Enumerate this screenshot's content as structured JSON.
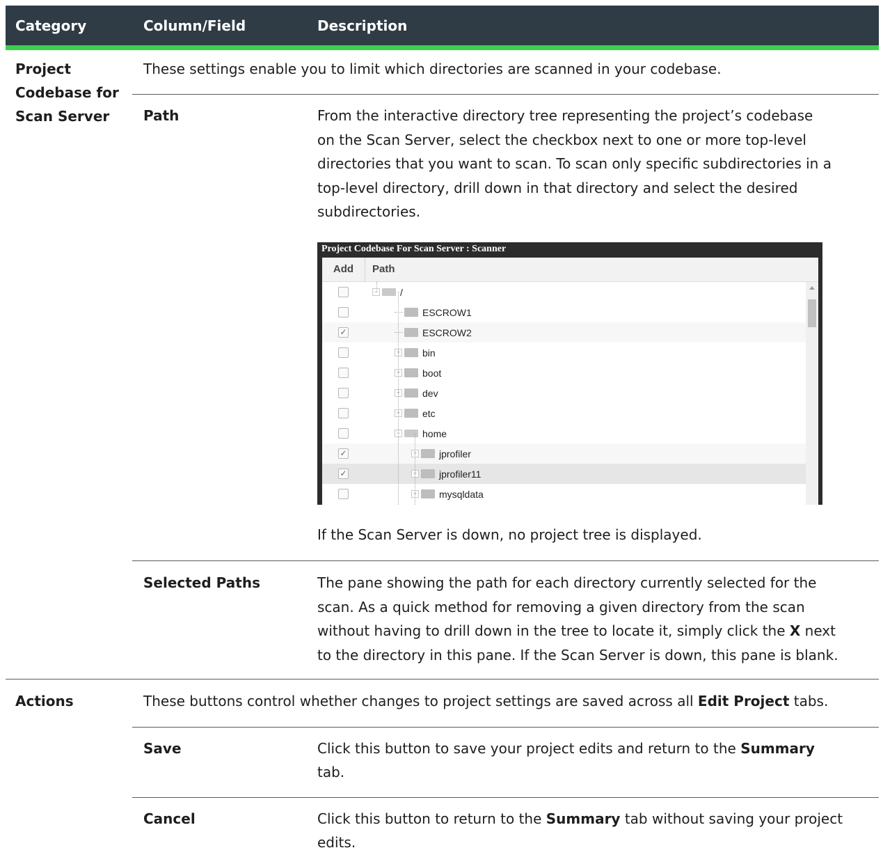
{
  "header": {
    "col_category": "Category",
    "col_field": "Column/Field",
    "col_description": "Description"
  },
  "section1": {
    "category_line1": "Project",
    "category_line2": "Codebase for",
    "category_line3": "Scan Server",
    "intro": "These settings enable you to limit which directories are scanned in your codebase.",
    "path_field": "Path",
    "path_desc": [
      "From the interactive directory tree representing the project’s codebase",
      "on the Scan Server, select the checkbox next to one or more top-level",
      "directories that you want to scan. To scan only specific subdirectories in a",
      "top-level directory, drill down in that directory and select the desired",
      "subdirectories."
    ],
    "tree_note": "If the Scan Server is down, no project tree is displayed.",
    "selected_field": "Selected Paths",
    "selected_desc": {
      "line1": "The pane showing the path for each directory currently selected for the",
      "line2": "scan. As a quick method for removing a given directory from the scan",
      "line3_pre": "without having to drill down in the tree to locate it, simply click the ",
      "line3_bold": "X",
      "line3_post": " next",
      "line4": "to the directory in this pane. If the Scan Server is down, this pane is blank."
    }
  },
  "tree": {
    "title": "Project Codebase For Scan Server : Scanner",
    "col_add": "Add",
    "col_path": "Path",
    "nodes": [
      {
        "label": "/",
        "checked": false
      },
      {
        "label": "ESCROW1",
        "checked": false
      },
      {
        "label": "ESCROW2",
        "checked": true
      },
      {
        "label": "bin",
        "checked": false
      },
      {
        "label": "boot",
        "checked": false
      },
      {
        "label": "dev",
        "checked": false
      },
      {
        "label": "etc",
        "checked": false
      },
      {
        "label": "home",
        "checked": false
      },
      {
        "label": "jprofiler",
        "checked": true
      },
      {
        "label": "jprofiler11",
        "checked": true
      },
      {
        "label": "mysqldata",
        "checked": false
      }
    ]
  },
  "section2": {
    "category": "Actions",
    "intro_pre": "These buttons control whether changes to project settings are saved across all ",
    "intro_bold": "Edit Project",
    "intro_post": " tabs.",
    "save_field": "Save",
    "save_pre": "Click this button to save your project edits and return to the ",
    "save_bold": "Summary",
    "save_line2": "tab.",
    "cancel_field": "Cancel",
    "cancel_pre": "Click this button to return to the ",
    "cancel_bold": "Summary",
    "cancel_post": " tab without saving your project",
    "cancel_line2": "edits."
  }
}
